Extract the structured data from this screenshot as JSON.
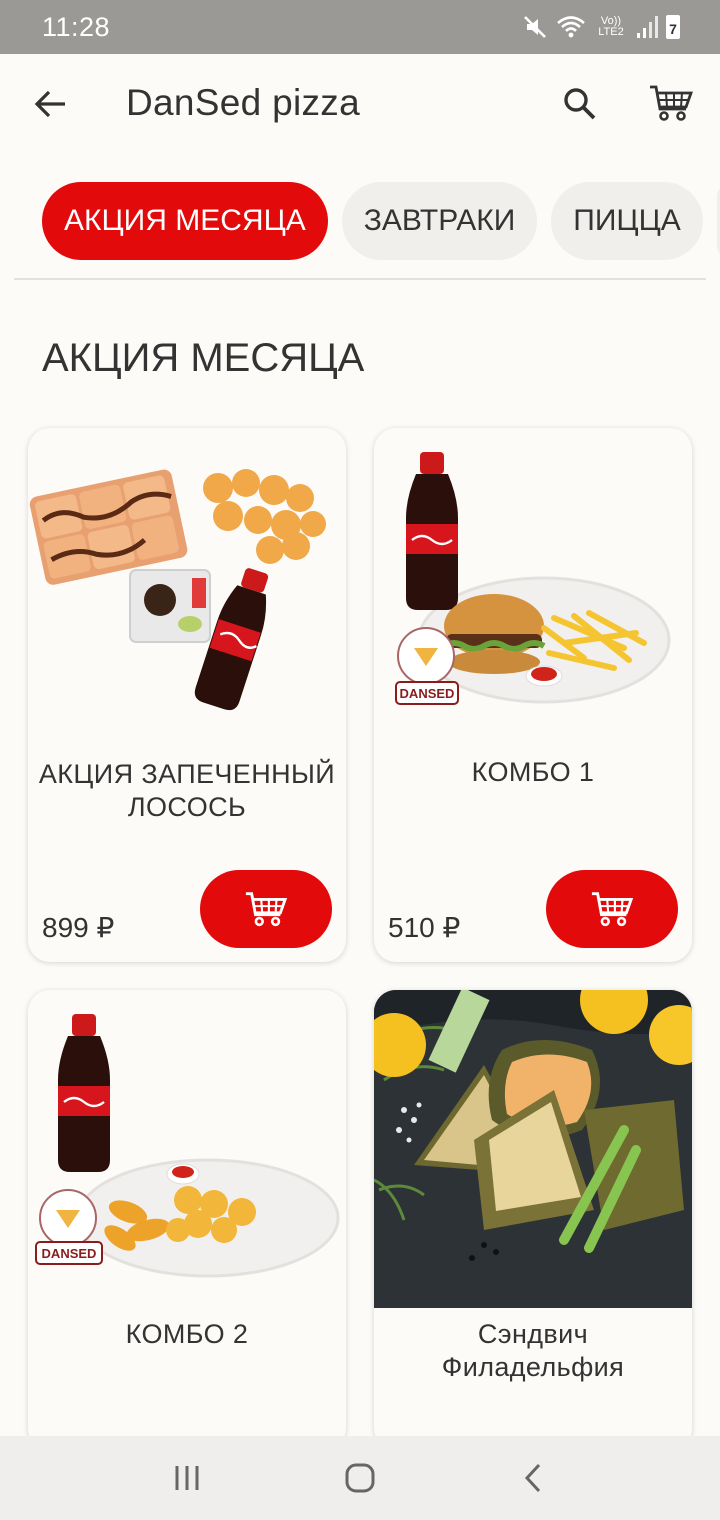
{
  "status_bar": {
    "time": "11:28",
    "network_label": "Vo)) LTE2",
    "battery_level": "7",
    "icons": [
      "mute-icon",
      "wifi-icon",
      "signal-icon",
      "battery-icon"
    ]
  },
  "app_bar": {
    "title": "DanSed pizza",
    "icons": [
      "back-arrow-icon",
      "search-icon",
      "cart-icon"
    ]
  },
  "tabs": [
    {
      "label": "АКЦИЯ МЕСЯЦА",
      "active": true
    },
    {
      "label": "ЗАВТРАКИ",
      "active": false
    },
    {
      "label": "ПИЦЦА",
      "active": false
    }
  ],
  "section": {
    "title": "АКЦИЯ МЕСЯЦА"
  },
  "products": [
    {
      "name": "АКЦИЯ ЗАПЕЧЕННЫЙ ЛОСОСЬ",
      "price": "899 ₽"
    },
    {
      "name": "КОМБО 1",
      "price": "510 ₽"
    },
    {
      "name": "КОМБО 2",
      "price": ""
    },
    {
      "name": "Сэндвич Филадельфия",
      "price": ""
    }
  ],
  "colors": {
    "accent": "#e20a0a",
    "background": "#fcfbf8",
    "chip": "#f0efec",
    "status_bar": "#9a9996"
  },
  "nav_bar": {
    "icons": [
      "recents-icon",
      "home-icon",
      "back-icon"
    ]
  }
}
